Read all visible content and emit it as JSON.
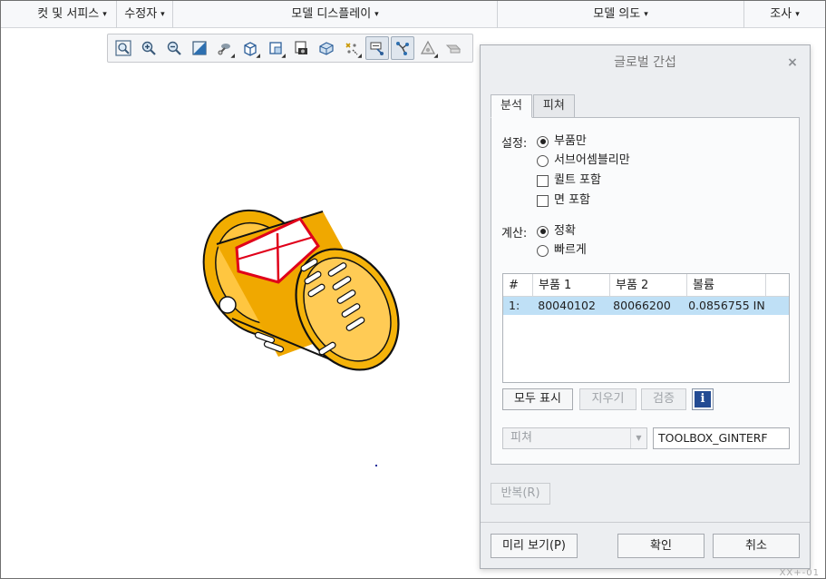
{
  "ribbon": {
    "groups": [
      {
        "label": "컷 및 서피스"
      },
      {
        "label": "수정자"
      },
      {
        "label": "모델 디스플레이"
      },
      {
        "label": "모델 의도"
      },
      {
        "label": "조사"
      }
    ],
    "arrow": "▾"
  },
  "graphics_toolbar": {
    "buttons": [
      {
        "icon": "zoom-fit-icon"
      },
      {
        "icon": "zoom-in-icon"
      },
      {
        "icon": "zoom-out-icon"
      },
      {
        "icon": "repaint-icon"
      },
      {
        "icon": "spin-center-icon"
      },
      {
        "icon": "display-style-icon"
      },
      {
        "icon": "saved-orientations-icon"
      },
      {
        "icon": "view-manager-icon"
      },
      {
        "icon": "perspective-view-icon"
      },
      {
        "icon": "datum-display-icon"
      },
      {
        "icon": "annotation-display-icon",
        "active": true
      },
      {
        "icon": "interference-display-icon",
        "active": true
      },
      {
        "icon": "appearance-icon"
      },
      {
        "icon": "section-icon"
      }
    ]
  },
  "dialog": {
    "title": "글로벌 간섭",
    "close": "×",
    "tabs": [
      {
        "label": "분석",
        "selected": true
      },
      {
        "label": "피쳐",
        "selected": false
      }
    ],
    "settings": {
      "label": "설정:",
      "options": [
        {
          "type": "radio",
          "label": "부품만",
          "checked": true
        },
        {
          "type": "radio",
          "label": "서브어셈블리만",
          "checked": false
        },
        {
          "type": "checkbox",
          "label": "퀼트 포함",
          "checked": false
        },
        {
          "type": "checkbox",
          "label": "면 포함",
          "checked": false
        }
      ]
    },
    "computation": {
      "label": "계산:",
      "options": [
        {
          "type": "radio",
          "label": "정확",
          "checked": true
        },
        {
          "type": "radio",
          "label": "빠르게",
          "checked": false
        }
      ]
    },
    "table": {
      "columns": [
        "#",
        "부품 1",
        "부품 2",
        "볼륨"
      ],
      "rows": [
        {
          "index": "1:",
          "part1": "80040102",
          "part2": "80066200",
          "volume": "0.0856755 IN"
        }
      ]
    },
    "buttons": {
      "show_all": "모두 표시",
      "clear": "지우기",
      "verify": "검증",
      "info": "i"
    },
    "feature_combo": {
      "value": "피쳐",
      "arrow": "▼"
    },
    "feature_name": "TOOLBOX_GINTERF",
    "repeat": "반복(R)",
    "preview": "미리 보기(P)",
    "ok": "확인",
    "cancel": "취소"
  },
  "corner_text": "XX+-01",
  "colors": {
    "model_fill": "#f0a800",
    "interference": "#e0001a",
    "selection": "#bfe0f6"
  }
}
